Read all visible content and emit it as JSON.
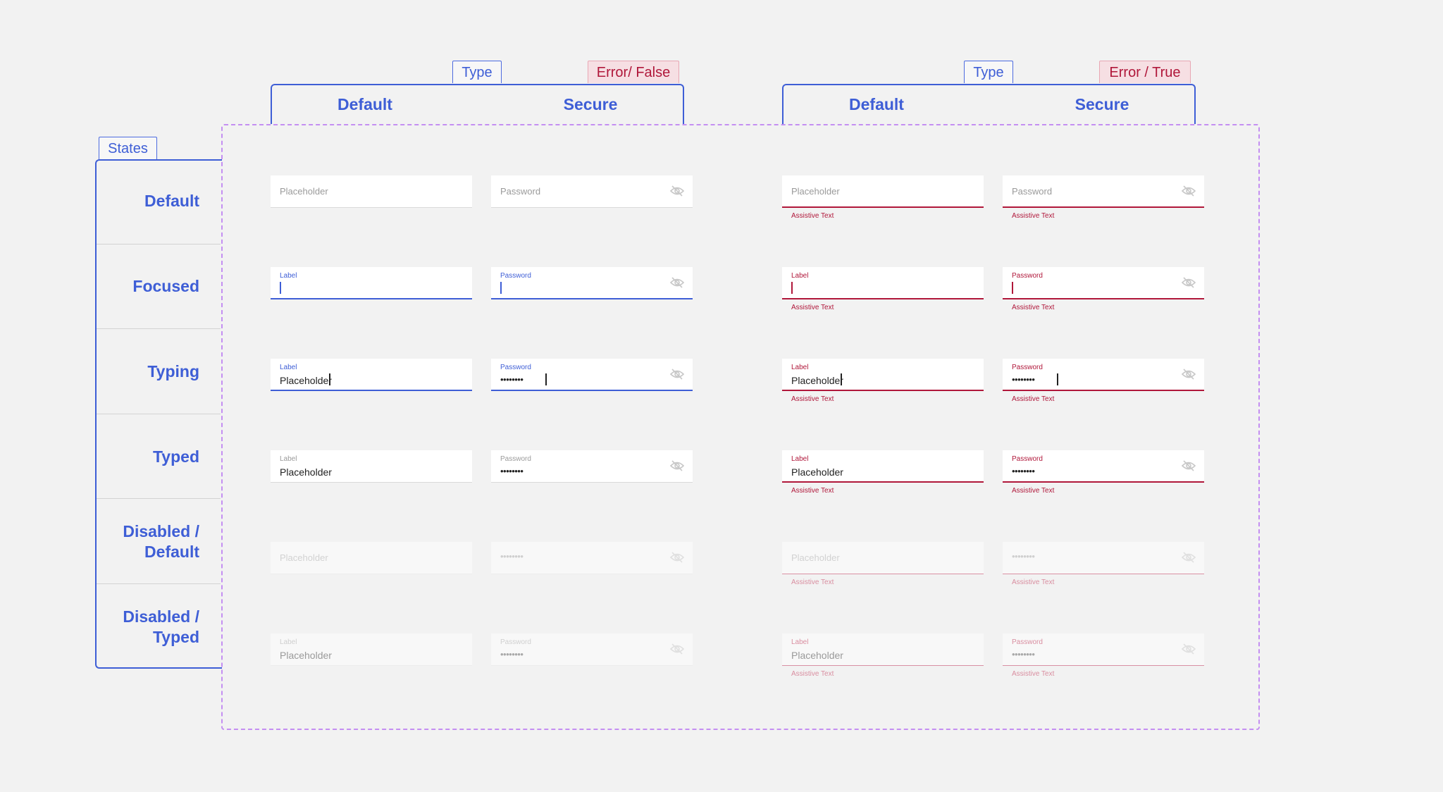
{
  "tags": {
    "type_left": "Type",
    "error_left": "Error/ False",
    "type_right": "Type",
    "error_right": "Error / True",
    "states": "States"
  },
  "columns": {
    "default": "Default",
    "secure": "Secure"
  },
  "rows": {
    "default": "Default",
    "focused": "Focused",
    "typing": "Typing",
    "typed": "Typed",
    "disabled_default_1": "Disabled /",
    "disabled_default_2": "Default",
    "disabled_typed_1": "Disabled /",
    "disabled_typed_2": "Typed"
  },
  "field": {
    "placeholder": "Placeholder",
    "password_placeholder": "Password",
    "label": "Label",
    "password_label": "Password",
    "value": "Placeholder",
    "secure_value": "••••••••",
    "assistive": "Assistive Text"
  },
  "icons": {
    "visibility_toggle": "eye-off-icon"
  },
  "colors": {
    "accent": "#3e5ed6",
    "error": "#b0173a",
    "frame": "#c48ff2",
    "background": "#f2f2f2"
  }
}
